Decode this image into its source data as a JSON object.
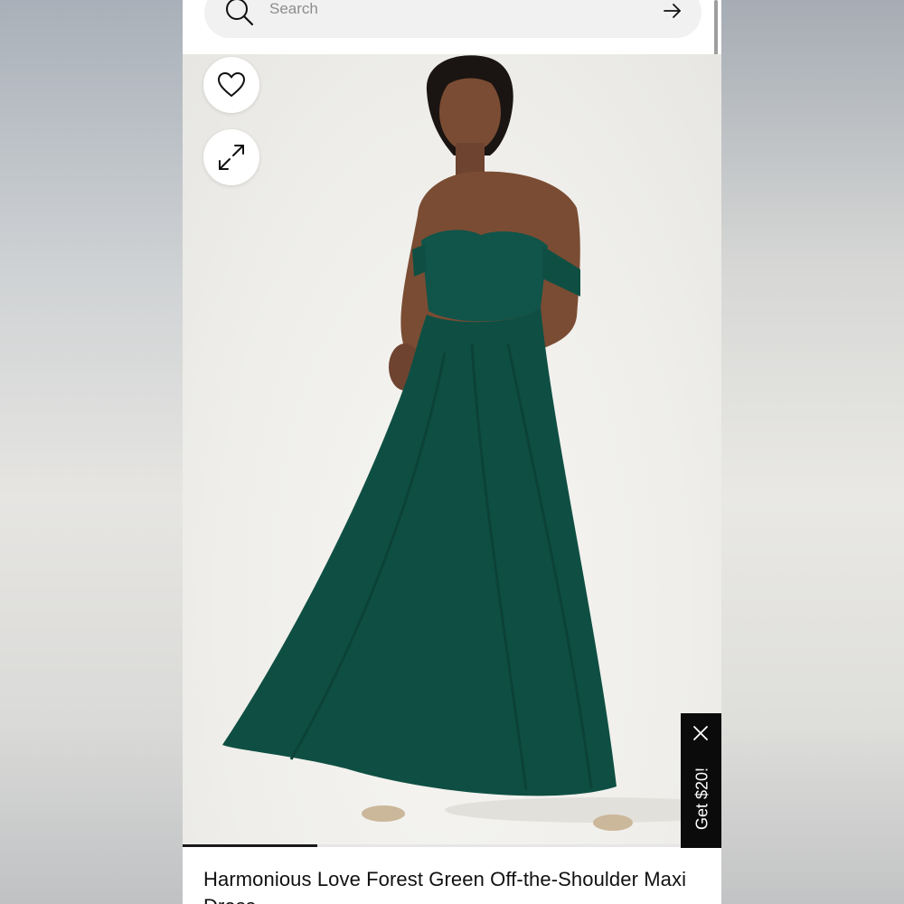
{
  "search": {
    "placeholder": "Search"
  },
  "product": {
    "title": "Harmonious Love Forest Green Off-the-Shoulder Maxi Dress",
    "image_alt": "model wearing green off-the-shoulder maxi dress",
    "gallery_progress": 0.25
  },
  "promo": {
    "label": "Get $20!"
  },
  "icons": {
    "search": "search-icon",
    "submit": "arrow-right-icon",
    "favorite": "heart-icon",
    "expand": "expand-icon",
    "close": "close-icon"
  },
  "colors": {
    "dress": "#0f4f43",
    "promo_bg": "#0b0b0b"
  }
}
